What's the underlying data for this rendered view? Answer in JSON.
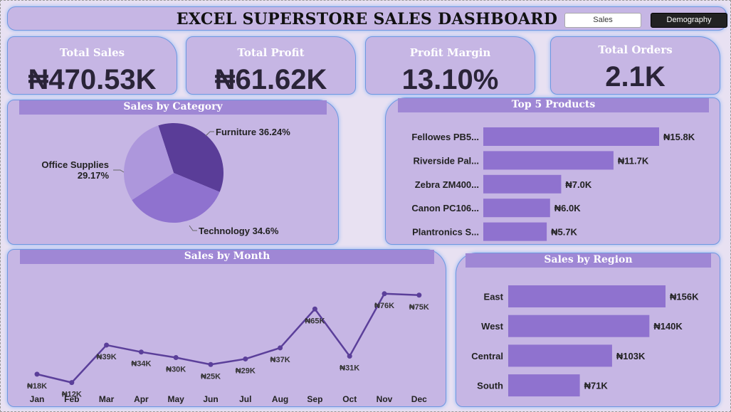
{
  "header": {
    "title": "EXCEL SUPERSTORE SALES DASHBOARD",
    "nav_sales": "Sales",
    "nav_demography": "Demography"
  },
  "kpis": [
    {
      "title": "Total Sales",
      "value": "₦470.53K"
    },
    {
      "title": "Total Profit",
      "value": "₦61.62K"
    },
    {
      "title": "Profit Margin",
      "value": "13.10%"
    },
    {
      "title": "Total Orders",
      "value": "2.1K"
    }
  ],
  "colors": {
    "panel": "#c6b6e4",
    "title_bar": "#9f87d5",
    "bar": "#8f72cf",
    "line": "#5b3f9a",
    "pie_furniture": "#5a3d98",
    "pie_technology": "#8f72cf",
    "pie_office": "#ad97dc"
  },
  "category": {
    "title": "Sales by Category",
    "chart_data": {
      "type": "pie",
      "slices": [
        {
          "label": "Furniture",
          "value": 36.24,
          "display": "Furniture 36.24%"
        },
        {
          "label": "Technology",
          "value": 34.6,
          "display": "Technology 34.6%"
        },
        {
          "label": "Office Supplies",
          "value": 29.17,
          "display": "29.17%"
        }
      ]
    }
  },
  "products": {
    "title": "Top 5 Products",
    "chart_data": {
      "type": "bar",
      "orientation": "horizontal",
      "categories": [
        "Fellowes PB5...",
        "Riverside Pal...",
        "Zebra ZM400...",
        "Canon PC106...",
        "Plantronics S..."
      ],
      "values": [
        15.8,
        11.7,
        7.0,
        6.0,
        5.7
      ],
      "labels": [
        "₦15.8K",
        "₦11.7K",
        "₦7.0K",
        "₦6.0K",
        "₦5.7K"
      ]
    }
  },
  "month": {
    "title": "Sales by Month",
    "chart_data": {
      "type": "line",
      "categories": [
        "Jan",
        "Feb",
        "Mar",
        "Apr",
        "May",
        "Jun",
        "Jul",
        "Aug",
        "Sep",
        "Oct",
        "Nov",
        "Dec"
      ],
      "values": [
        18,
        12,
        39,
        34,
        30,
        25,
        29,
        37,
        65,
        31,
        76,
        75
      ],
      "labels": [
        "₦18K",
        "₦12K",
        "₦39K",
        "₦34K",
        "₦30K",
        "₦25K",
        "₦29K",
        "₦37K",
        "₦65K",
        "₦31K",
        "₦76K",
        "₦75K"
      ]
    }
  },
  "region": {
    "title": "Sales by Region",
    "chart_data": {
      "type": "bar",
      "orientation": "horizontal",
      "categories": [
        "East",
        "West",
        "Central",
        "South"
      ],
      "values": [
        156,
        140,
        103,
        71
      ],
      "labels": [
        "₦156K",
        "₦140K",
        "₦103K",
        "₦71K"
      ]
    }
  }
}
